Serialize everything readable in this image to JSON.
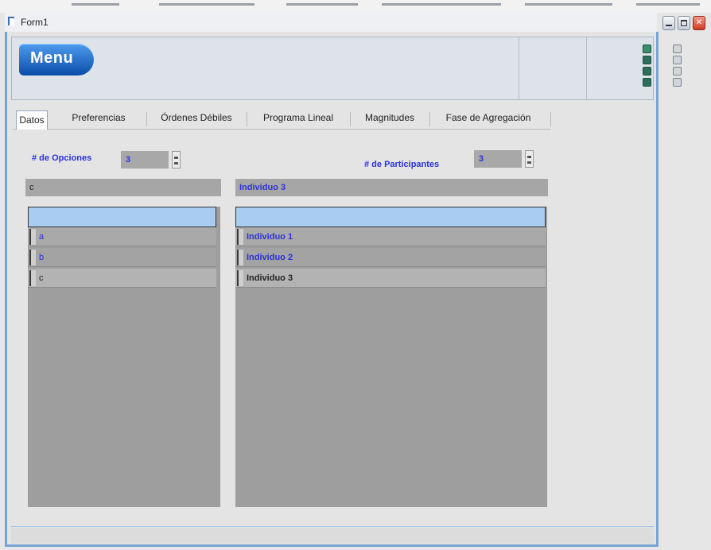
{
  "window": {
    "title": "Form1"
  },
  "menu": {
    "label": "Menu"
  },
  "tabs": [
    {
      "label": "Datos"
    },
    {
      "label": "Preferencias"
    },
    {
      "label": "Órdenes Débiles"
    },
    {
      "label": "Programa Lineal"
    },
    {
      "label": "Magnitudes"
    },
    {
      "label": "Fase de Agregación"
    }
  ],
  "selected_tab": "Datos",
  "opciones": {
    "label": "# de Opciones",
    "value": "3",
    "current": "c",
    "rows": [
      "a",
      "b",
      "c"
    ]
  },
  "participantes": {
    "label": "# de Participantes",
    "value": "3",
    "current": "Individuo 3",
    "rows": [
      "Individuo 1",
      "Individuo 2",
      "Individuo 3"
    ]
  },
  "colors": {
    "accent": "#2c32d8",
    "frame": "#78a4d4",
    "grid_header": "#a9cdf2",
    "grid_body": "#9e9e9e",
    "menu_button": "#0a4ca8"
  }
}
